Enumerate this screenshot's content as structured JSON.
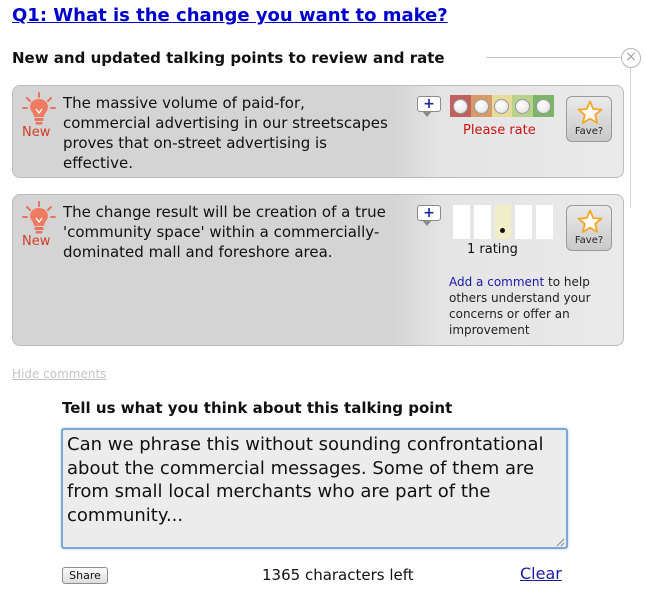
{
  "question": {
    "title": "Q1: What is the change you want to make?"
  },
  "section": {
    "heading": "New and updated talking points to review and rate",
    "close_symbol": "×"
  },
  "points": [
    {
      "badge": "New",
      "text": "The massive volume of paid-for, commercial advertising in our streetscapes proves that on-street advertising is effective.",
      "add_symbol": "+",
      "rating_prompt": "Please rate",
      "rating_scale_colors": [
        "#c26060",
        "#d99a6a",
        "#e6dc9a",
        "#b9d28a",
        "#7db46c"
      ],
      "fave_label": "Fave?"
    },
    {
      "badge": "New",
      "text": "The change result will be creation of a true 'community space' within a commercially-dominated mall and foreshore area.",
      "add_symbol": "+",
      "rating_distribution": [
        0,
        0,
        1,
        0,
        0
      ],
      "rating_count": "1 rating",
      "fave_label": "Fave?",
      "help_link": "Add a comment",
      "help_text": " to help others understand your concerns or offer an improvement"
    }
  ],
  "hide_comments": "Hide comments",
  "comment": {
    "prompt": "Tell us what you think about this talking point",
    "value": "Can we phrase this without sounding confrontational about the commercial messages. Some of them are from small local merchants who are part of the community..."
  },
  "share_label": "Share",
  "chars_left": "1365 characters left",
  "clear_label": "Clear",
  "colors": {
    "title_link": "#0000cc",
    "new_badge": "#d43c22",
    "please_rate": "#cc1111",
    "link": "#1a1aa6",
    "star_fill": "#f5a623"
  },
  "icons": [
    "lightbulb-icon",
    "plus-icon",
    "star-icon",
    "close-icon",
    "resize-grip-icon"
  ]
}
